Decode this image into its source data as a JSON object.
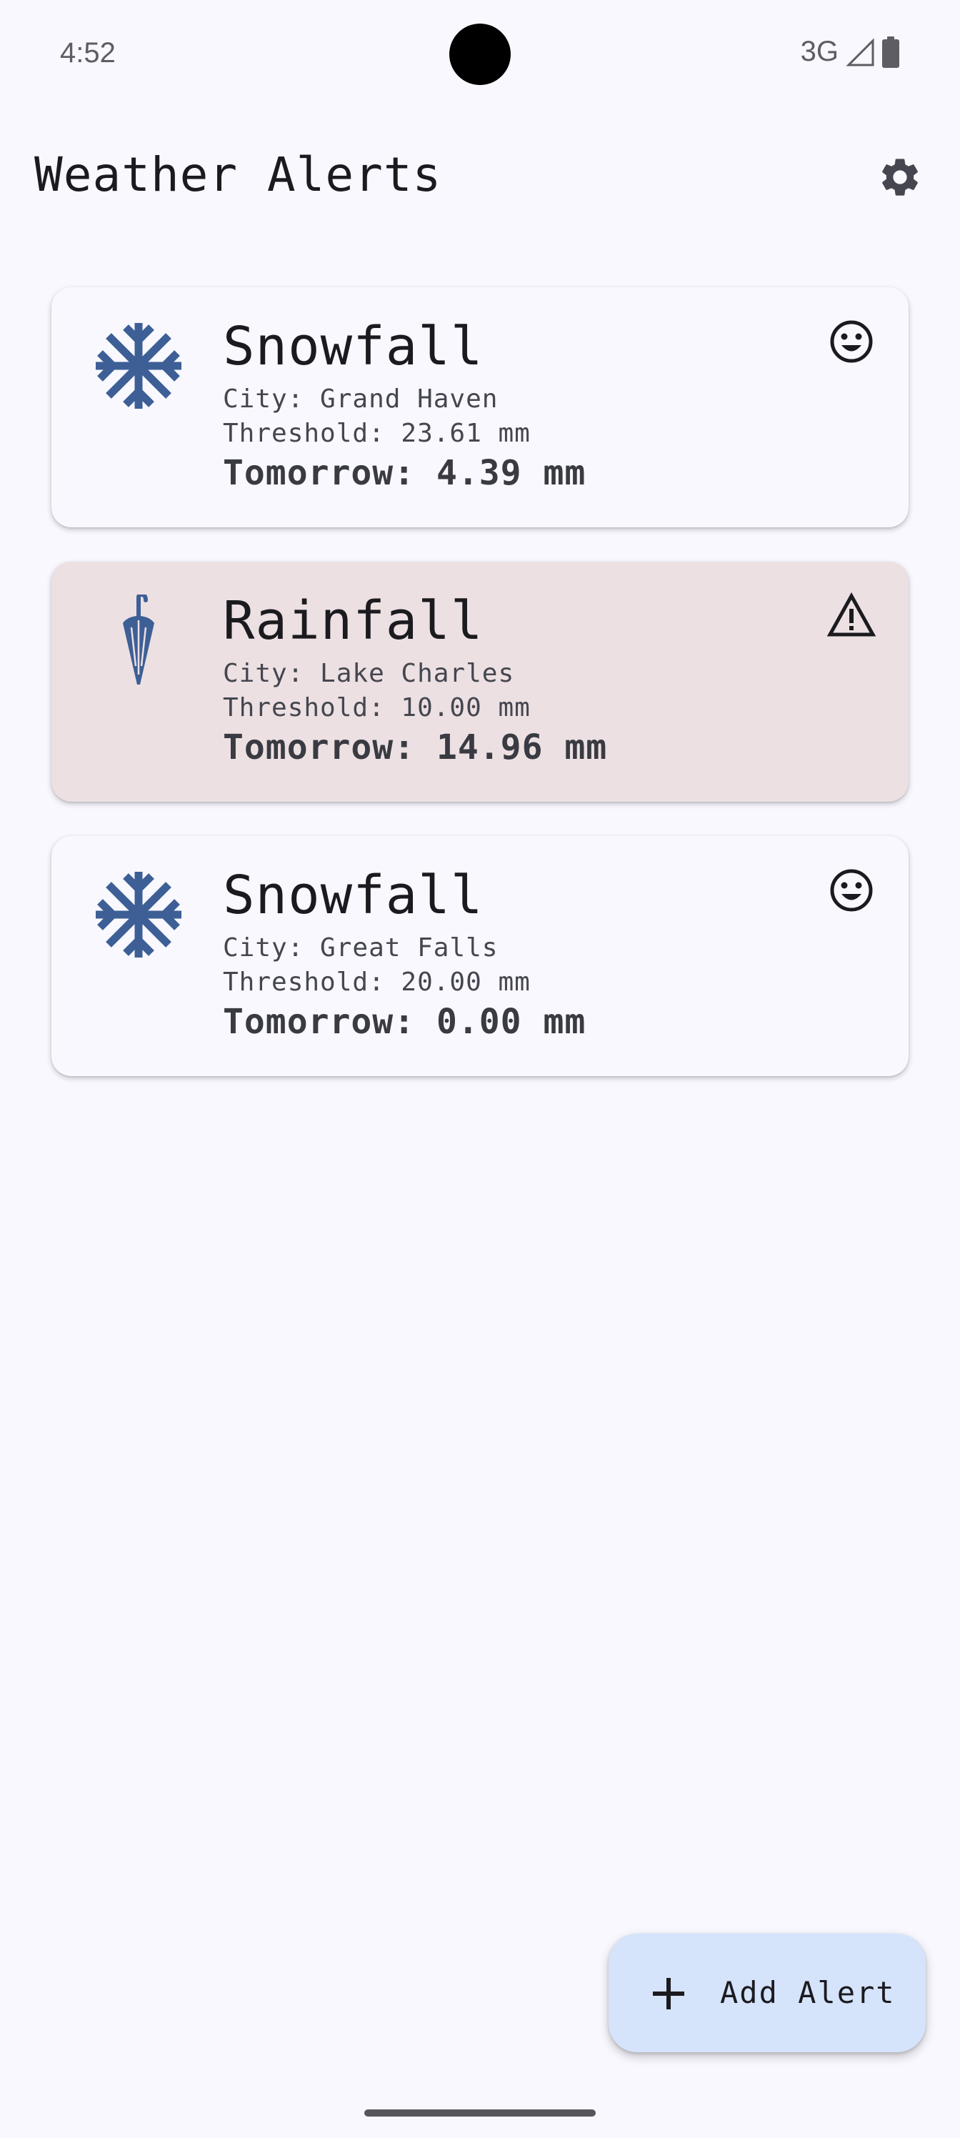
{
  "status_bar": {
    "time": "4:52",
    "network": "3G",
    "icons": [
      "signal-icon",
      "battery-icon"
    ]
  },
  "app_bar": {
    "title": "Weather Alerts",
    "settings_icon": "gear-icon"
  },
  "alerts": [
    {
      "type": "Snowfall",
      "icon": "snowflake-icon",
      "city": "City: Grand Haven",
      "threshold": "Threshold: 23.61 mm",
      "forecast": "Tomorrow: 4.39 mm",
      "status_icon": "smiley-icon",
      "triggered": false
    },
    {
      "type": "Rainfall",
      "icon": "umbrella-icon",
      "city": "City: Lake Charles",
      "threshold": "Threshold: 10.00 mm",
      "forecast": "Tomorrow: 14.96 mm",
      "status_icon": "warning-icon",
      "triggered": true
    },
    {
      "type": "Snowfall",
      "icon": "snowflake-icon",
      "city": "City: Great Falls",
      "threshold": "Threshold: 20.00 mm",
      "forecast": "Tomorrow: 0.00 mm",
      "status_icon": "smiley-icon",
      "triggered": false
    }
  ],
  "fab": {
    "label": "Add Alert",
    "icon": "plus-icon"
  },
  "colors": {
    "background": "#f8f8fe",
    "triggered_card": "#ece0e2",
    "icon_accent": "#3d5f96",
    "fab_background": "#d5e3fb"
  }
}
